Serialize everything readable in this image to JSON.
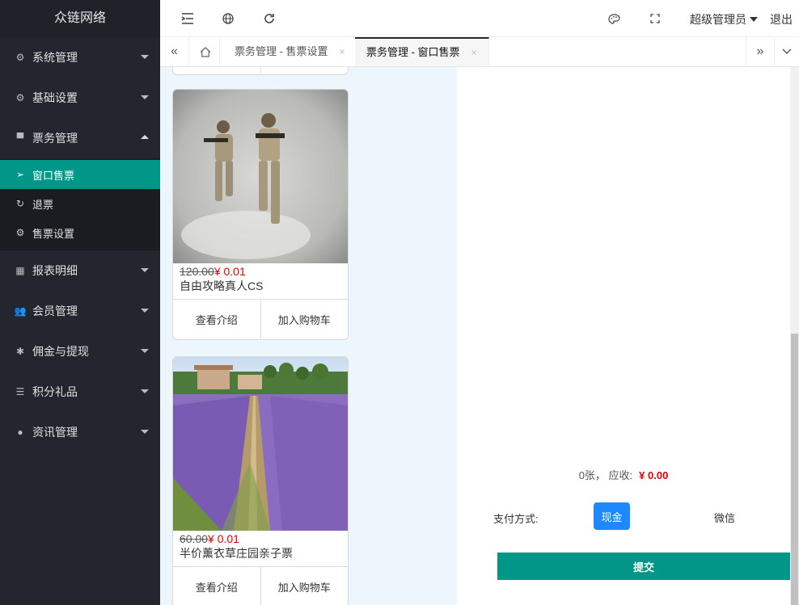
{
  "app": {
    "title": "众链网络"
  },
  "sidebar": {
    "items": [
      {
        "label": "系统管理",
        "icon": "gear-icon"
      },
      {
        "label": "基础设置",
        "icon": "gear-icon"
      },
      {
        "label": "票务管理",
        "icon": "ticket-icon",
        "expanded": true
      },
      {
        "label": "报表明细",
        "icon": "table-icon"
      },
      {
        "label": "会员管理",
        "icon": "users-icon"
      },
      {
        "label": "佣金与提现",
        "icon": "bug-icon"
      },
      {
        "label": "积分礼品",
        "icon": "list-icon"
      },
      {
        "label": "资讯管理",
        "icon": "circle-icon"
      }
    ],
    "subitems": [
      {
        "label": "窗口售票",
        "icon": "send-icon",
        "active": true
      },
      {
        "label": "退票",
        "icon": "refresh-icon"
      },
      {
        "label": "售票设置",
        "icon": "gear-icon"
      }
    ]
  },
  "header": {
    "user": "超级管理员",
    "logout": "退出"
  },
  "tabs": [
    {
      "label": "票务管理 - 售票设置",
      "close": "×"
    },
    {
      "label": "票务管理 - 窗口售票",
      "close": "×",
      "active": true
    }
  ],
  "products": [
    {
      "old_price": "120.00",
      "price": "¥ 0.01",
      "name": "自由攻略真人CS",
      "intro_btn": "查看介绍",
      "cart_btn": "加入购物车",
      "image": "soldiers-image"
    },
    {
      "old_price": "60.00",
      "price": "¥ 0.01",
      "name": "半价薰衣草庄园亲子票",
      "intro_btn": "查看介绍",
      "cart_btn": "加入购物车",
      "image": "lavender-field-image"
    }
  ],
  "order": {
    "count_text": "0张，  应收:",
    "amount": "¥ 0.00",
    "pay_label": "支付方式:",
    "pay_cash": "现金",
    "pay_wechat": "微信",
    "submit": "提交"
  },
  "colors": {
    "sidebar_bg": "#23262e",
    "accent": "#009688",
    "price_red": "#e40000",
    "cash_blue": "#1e88ff"
  }
}
